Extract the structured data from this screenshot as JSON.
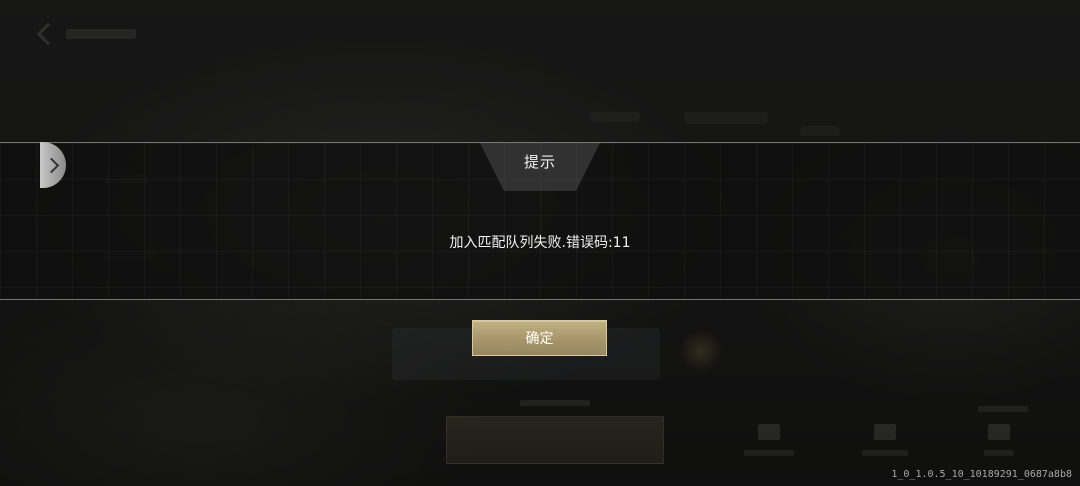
{
  "dialog": {
    "title": "提示",
    "message": "加入匹配队列失败.错误码:11",
    "confirm_label": "确定"
  },
  "build_version": "1_0_1.0.5_10_10189291_0687a8b8",
  "colors": {
    "confirm_button": "#b3a277",
    "dialog_border": "#c8c8c8"
  }
}
